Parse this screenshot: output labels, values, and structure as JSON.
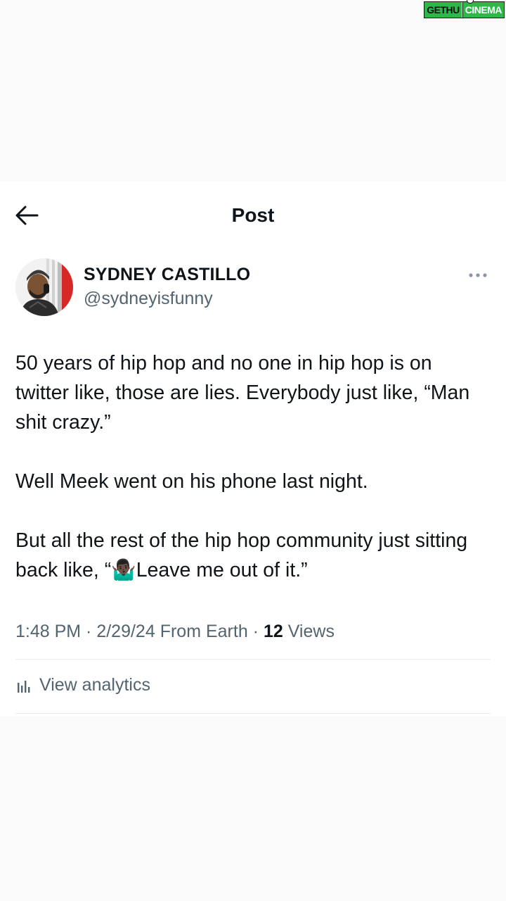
{
  "watermark": {
    "left_text": "GETHU",
    "right_text": "CINEMA"
  },
  "header": {
    "title": "Post",
    "back_icon": "arrow-left-icon"
  },
  "author": {
    "name": "SYDNEY CASTILLO",
    "handle": "@sydneyisfunny",
    "more_icon": "more-horizontal-icon"
  },
  "tweet": {
    "paragraphs": [
      "50 years of hip hop and no one in hip hop is on twitter like, those are lies. Everybody just like, “Man shit crazy.”",
      "Well Meek went on his phone last night.",
      "But all the rest of the hip hop community just sitting back like, “🤷🏿‍♂️Leave me out of it.”"
    ]
  },
  "meta": {
    "time": "1:48 PM",
    "separator1": " · ",
    "date": "2/29/24",
    "location": " From Earth",
    "separator2": " · ",
    "views_count": "12",
    "views_label": " Views"
  },
  "analytics": {
    "label": "View analytics",
    "icon": "bar-chart-icon"
  },
  "colors": {
    "text_primary": "#0f1419",
    "text_secondary": "#536471",
    "divider": "#e6ecf0",
    "watermark_green": "#2fb84a"
  }
}
